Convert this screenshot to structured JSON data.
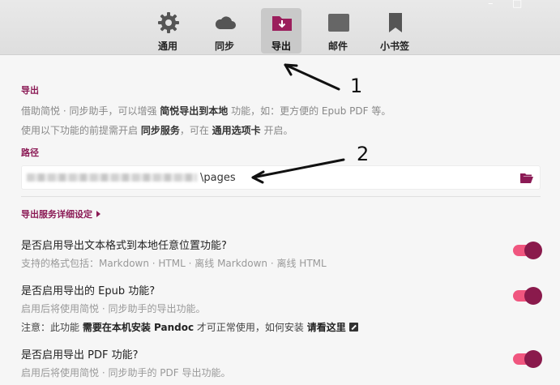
{
  "toolbar": {
    "window_controls": [
      "–",
      "□"
    ],
    "tabs": [
      {
        "label": "通用",
        "icon": "gear-icon",
        "active": false
      },
      {
        "label": "同步",
        "icon": "cloud-icon",
        "active": false
      },
      {
        "label": "导出",
        "icon": "folder-export-icon",
        "active": true
      },
      {
        "label": "邮件",
        "icon": "mail-icon",
        "active": false
      },
      {
        "label": "小书签",
        "icon": "bookmark-icon",
        "active": false
      }
    ]
  },
  "export": {
    "title": "导出",
    "desc1_a": "借助简悦 · 同步助手，可以增强 ",
    "desc1_b": "简悦导出到本地",
    "desc1_c": " 功能，如：更方便的 Epub PDF 等。",
    "desc2_a": "使用以下功能的前提需开启 ",
    "desc2_b": "同步服务",
    "desc2_c": "，可在 ",
    "desc2_d": "通用选项卡",
    "desc2_e": " 开启。"
  },
  "path": {
    "label": "路径",
    "value": "\\pages"
  },
  "advanced_label": "导出服务详细设定",
  "settings": [
    {
      "question": "是否启用导出文本格式到本地任意位置功能?",
      "hint": "支持的格式包括：Markdown · HTML · 离线 Markdown · 离线 HTML",
      "enabled": true
    },
    {
      "question": "是否启用导出的 Epub 功能?",
      "hint": "启用后将使用简悦 · 同步助手的导出功能。",
      "enabled": true
    },
    {
      "question": "是否启用导出 PDF 功能?",
      "hint": "启用后将使用简悦 · 同步助手的 PDF 导出功能。",
      "enabled": true
    }
  ],
  "epub_note": {
    "a": "注意：此功能 ",
    "b": "需要在本机安装 Pandoc",
    "c": " 才可正常使用，如何安装 ",
    "d": "请看这里"
  },
  "annotations": {
    "one": "1",
    "two": "2"
  },
  "colors": {
    "accent": "#8b1a55",
    "toggle_track": "#f0567f",
    "toggle_knob": "#8a1a4c"
  }
}
